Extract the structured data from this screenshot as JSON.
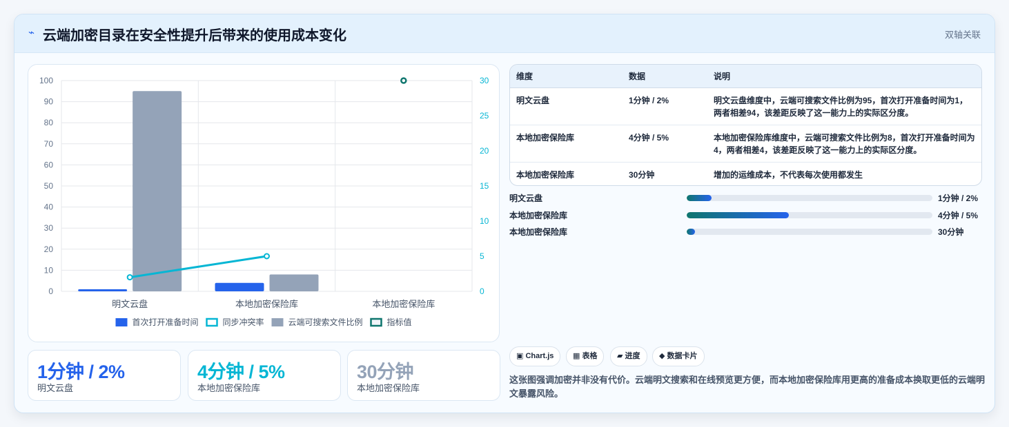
{
  "header": {
    "icon": "lightning-icon",
    "title": "云端加密目录在安全性提升后带来的使用成本变化",
    "badge": "双轴关联"
  },
  "chart_data": {
    "type": "bar",
    "categories": [
      "明文云盘",
      "本地加密保险库",
      "本地加密保险库"
    ],
    "series": [
      {
        "name": "首次打开准备时间",
        "type": "bar",
        "axis": "left",
        "color": "#2563eb",
        "values": [
          1,
          4,
          null
        ]
      },
      {
        "name": "同步冲突率",
        "type": "line",
        "axis": "right",
        "color": "#06b6d4",
        "values": [
          2,
          5,
          null
        ]
      },
      {
        "name": "云端可搜索文件比例",
        "type": "bar",
        "axis": "left",
        "color": "#94a3b8",
        "values": [
          95,
          8,
          null
        ]
      },
      {
        "name": "指标值",
        "type": "scatter",
        "axis": "right",
        "color": "#0f766e",
        "values": [
          null,
          null,
          30
        ]
      }
    ],
    "y_left": {
      "min": 0,
      "max": 100,
      "ticks": [
        0,
        10,
        20,
        30,
        40,
        50,
        60,
        70,
        80,
        90,
        100
      ]
    },
    "y_right": {
      "min": 0,
      "max": 30,
      "ticks": [
        0,
        5,
        10,
        15,
        20,
        25,
        30
      ]
    },
    "grid": true,
    "legend": "bottom"
  },
  "kpis": [
    {
      "value": "1分钟 / 2%",
      "label": "明文云盘",
      "color": "#2563eb"
    },
    {
      "value": "4分钟 / 5%",
      "label": "本地加密保险库",
      "color": "#06b6d4"
    },
    {
      "value": "30分钟",
      "label": "本地加密保险库",
      "color": "#94a3b8"
    }
  ],
  "table": {
    "headers": [
      "维度",
      "数据",
      "说明"
    ],
    "rows": [
      {
        "dim": "明文云盘",
        "data": "1分钟 / 2%",
        "desc": "明文云盘维度中，云端可搜索文件比例为95，首次打开准备时间为1，两者相差94，该差距反映了这一能力上的实际区分度。"
      },
      {
        "dim": "本地加密保险库",
        "data": "4分钟 / 5%",
        "desc": "本地加密保险库维度中，云端可搜索文件比例为8，首次打开准备时间为4，两者相差4，该差距反映了这一能力上的实际区分度。"
      },
      {
        "dim": "本地加密保险库",
        "data": "30分钟",
        "desc": "增加的运维成本，不代表每次使用都发生"
      }
    ]
  },
  "progress": [
    {
      "label": "明文云盘",
      "value": "1分钟 / 2%",
      "fraction": 0.1
    },
    {
      "label": "本地加密保险库",
      "value": "4分钟 / 5%",
      "fraction": 0.415
    },
    {
      "label": "本地加密保险库",
      "value": "30分钟",
      "fraction": 0.033
    }
  ],
  "tags": [
    {
      "icon": "chart-icon",
      "text": "▣ Chart.js"
    },
    {
      "icon": "table-icon",
      "text": "▦ 表格"
    },
    {
      "icon": "progress-icon",
      "text": "▰ 进度"
    },
    {
      "icon": "card-icon",
      "text": "◆ 数据卡片"
    }
  ],
  "note": "这张图强调加密并非没有代价。云端明文搜索和在线预览更方便，而本地加密保险库用更高的准备成本换取更低的云端明文暴露风险。"
}
